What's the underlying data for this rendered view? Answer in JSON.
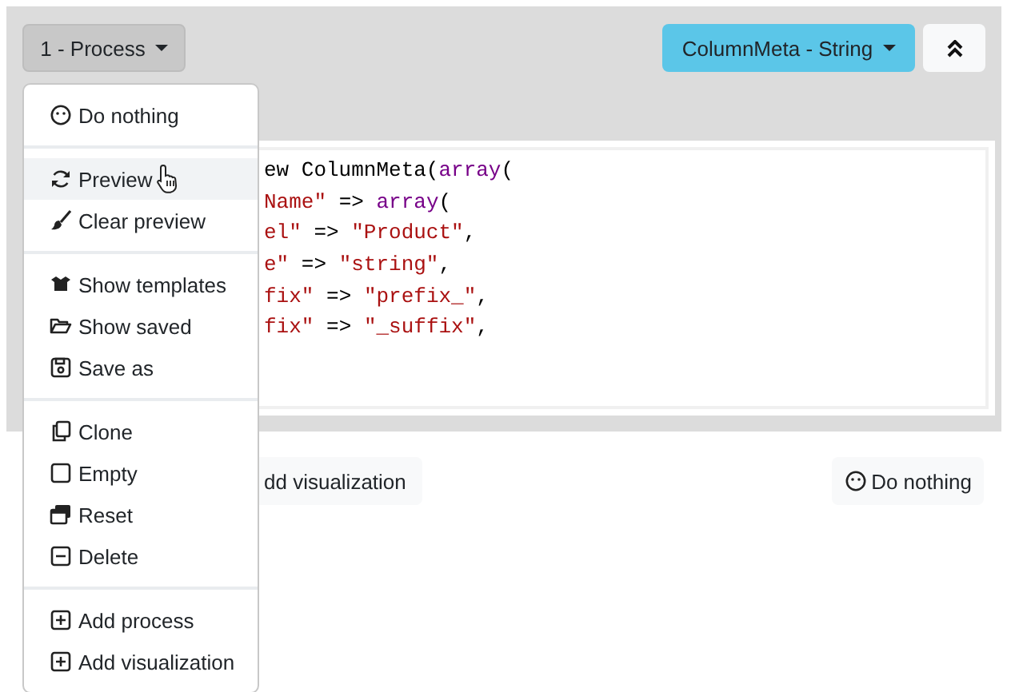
{
  "toolbar": {
    "process_button": {
      "label": "1 - Process"
    },
    "type_button": {
      "label": "ColumnMeta - String"
    }
  },
  "code_editor": {
    "lines": [
      [
        {
          "kind": "plain",
          "text": "ew ColumnMeta("
        },
        {
          "kind": "keyword",
          "text": "array"
        },
        {
          "kind": "plain",
          "text": "("
        }
      ],
      [
        {
          "kind": "string",
          "text": "Name\""
        },
        {
          "kind": "plain",
          "text": " => "
        },
        {
          "kind": "keyword",
          "text": "array"
        },
        {
          "kind": "plain",
          "text": "("
        }
      ],
      [
        {
          "kind": "string",
          "text": "el\""
        },
        {
          "kind": "plain",
          "text": " => "
        },
        {
          "kind": "string",
          "text": "\"Product\""
        },
        {
          "kind": "plain",
          "text": ","
        }
      ],
      [
        {
          "kind": "string",
          "text": "e\""
        },
        {
          "kind": "plain",
          "text": " => "
        },
        {
          "kind": "string",
          "text": "\"string\""
        },
        {
          "kind": "plain",
          "text": ","
        }
      ],
      [
        {
          "kind": "string",
          "text": "fix\""
        },
        {
          "kind": "plain",
          "text": " => "
        },
        {
          "kind": "string",
          "text": "\"prefix_\""
        },
        {
          "kind": "plain",
          "text": ","
        }
      ],
      [
        {
          "kind": "string",
          "text": "fix\""
        },
        {
          "kind": "plain",
          "text": " => "
        },
        {
          "kind": "string",
          "text": "\"_suffix\""
        },
        {
          "kind": "plain",
          "text": ","
        }
      ]
    ]
  },
  "dropdown_menu": {
    "sections": [
      {
        "items": [
          {
            "label": "Do nothing",
            "selected": false
          }
        ]
      },
      {
        "items": [
          {
            "label": "Preview",
            "selected": true
          },
          {
            "label": "Clear preview",
            "selected": false
          }
        ]
      },
      {
        "items": [
          {
            "label": "Show templates",
            "selected": false
          },
          {
            "label": "Show saved",
            "selected": false
          },
          {
            "label": "Save as",
            "selected": false
          }
        ]
      },
      {
        "items": [
          {
            "label": "Clone",
            "selected": false
          },
          {
            "label": "Empty",
            "selected": false
          },
          {
            "label": "Reset",
            "selected": false
          },
          {
            "label": "Delete",
            "selected": false
          }
        ]
      },
      {
        "items": [
          {
            "label": "Add process",
            "selected": false
          },
          {
            "label": "Add visualization",
            "selected": false
          }
        ]
      }
    ]
  },
  "footer": {
    "left_button": {
      "label": "dd visualization"
    },
    "right_button": {
      "label": "Do nothing"
    }
  }
}
